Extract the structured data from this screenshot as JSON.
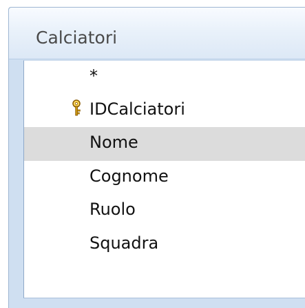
{
  "table_window": {
    "title": "Calciatori",
    "fields": [
      {
        "label": "*",
        "is_primary_key": false,
        "selected": false
      },
      {
        "label": "IDCalciatori",
        "is_primary_key": true,
        "selected": false,
        "icon": "key-icon"
      },
      {
        "label": "Nome",
        "is_primary_key": false,
        "selected": true
      },
      {
        "label": "Cognome",
        "is_primary_key": false,
        "selected": false
      },
      {
        "label": "Ruolo",
        "is_primary_key": false,
        "selected": false
      },
      {
        "label": "Squadra",
        "is_primary_key": false,
        "selected": false
      }
    ]
  },
  "colors": {
    "border": "#9eb6d2",
    "title_bar_bg": "#e9f1fa",
    "selected_row_bg": "#dcdcdc",
    "key_icon": "#d9a514"
  }
}
